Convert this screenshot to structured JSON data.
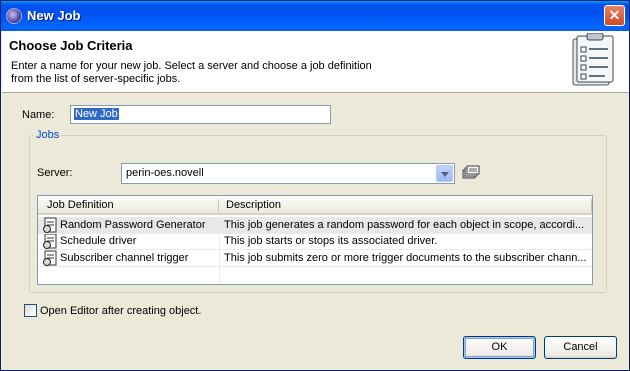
{
  "window": {
    "title": "New Job"
  },
  "header": {
    "title": "Choose Job Criteria",
    "description_line1": "Enter a name for your new job. Select a server and choose a job definition",
    "description_line2": "from the list of server-specific jobs."
  },
  "name_field": {
    "label": "Name:",
    "value": "New Job"
  },
  "jobs_group": {
    "legend": "Jobs",
    "server_label": "Server:",
    "server_value": "perin-oes.novell",
    "columns": [
      "Job Definition",
      "Description"
    ],
    "rows": [
      {
        "definition": "Random Password Generator",
        "description": "This job generates a random password for each object in scope, accordi..."
      },
      {
        "definition": "Schedule driver",
        "description": "This job starts or stops its associated driver."
      },
      {
        "definition": "Subscriber channel trigger",
        "description": "This job submits zero or more trigger documents to the subscriber chann..."
      }
    ]
  },
  "open_editor": {
    "label": "Open Editor after creating object.",
    "checked": false
  },
  "buttons": {
    "ok": "OK",
    "cancel": "Cancel"
  }
}
